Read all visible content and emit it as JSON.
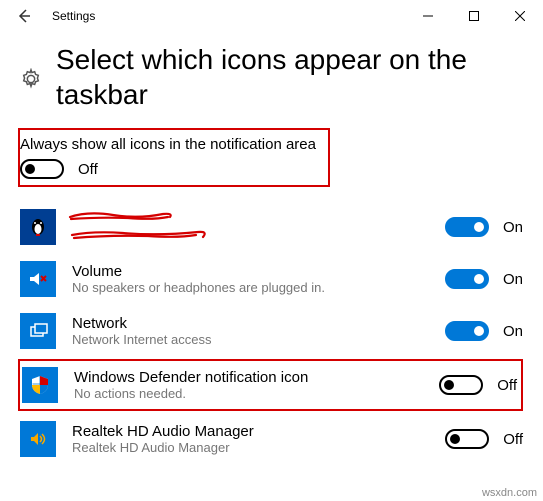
{
  "window": {
    "title": "Settings"
  },
  "page": {
    "heading": "Select which icons appear on the taskbar"
  },
  "master": {
    "label": "Always show all icons in the notification area",
    "state": "Off"
  },
  "items": [
    {
      "title": "",
      "subtitle": "",
      "state": "On"
    },
    {
      "title": "Volume",
      "subtitle": "No speakers or headphones are plugged in.",
      "state": "On"
    },
    {
      "title": "Network",
      "subtitle": "Network Internet access",
      "state": "On"
    },
    {
      "title": "Windows Defender notification icon",
      "subtitle": "No actions needed.",
      "state": "Off"
    },
    {
      "title": "Realtek HD Audio Manager",
      "subtitle": "Realtek HD Audio Manager",
      "state": "Off"
    }
  ],
  "watermark": "wsxdn.com"
}
